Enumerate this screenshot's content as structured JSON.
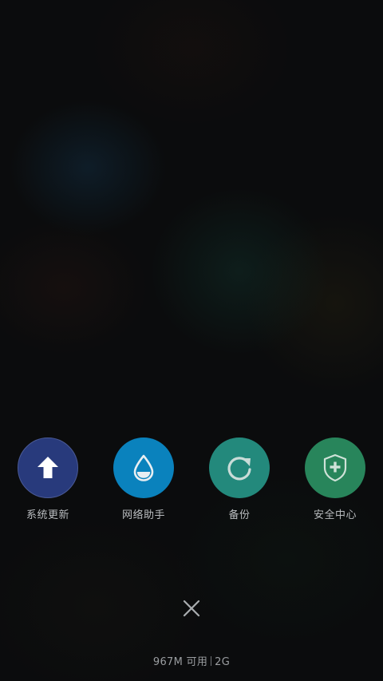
{
  "apps": [
    {
      "label": "系统更新",
      "icon": "upload-arrow-icon",
      "color": "#283a7c",
      "border": "#4a5a96"
    },
    {
      "label": "网络助手",
      "icon": "water-drop-icon",
      "color": "#0a82bd"
    },
    {
      "label": "备份",
      "icon": "refresh-icon",
      "color": "#23897c"
    },
    {
      "label": "安全中心",
      "icon": "shield-plus-icon",
      "color": "#28855b"
    }
  ],
  "close": {
    "icon": "close-icon"
  },
  "memory": {
    "available": "967M 可用",
    "total": "2G"
  }
}
